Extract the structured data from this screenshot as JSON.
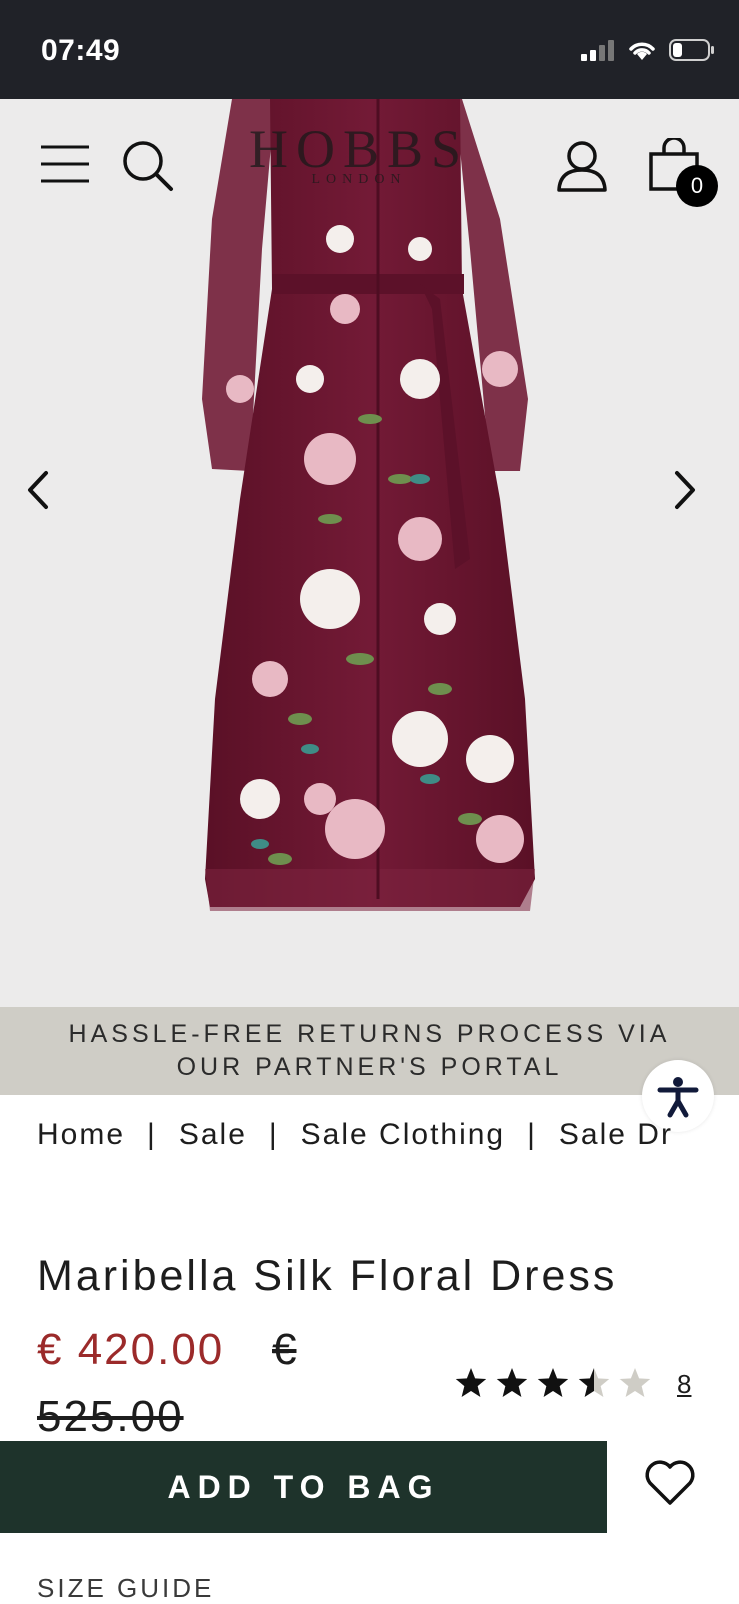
{
  "status_bar": {
    "time": "07:49"
  },
  "header": {
    "logo_main": "HOBBS",
    "logo_sub": "LONDON",
    "cart_count": "0"
  },
  "gallery": {
    "slide_count": 6,
    "active_index": 1
  },
  "banner": {
    "line1": "HASSLE-FREE RETURNS PROCESS VIA",
    "line2": "OUR PARTNER'S PORTAL"
  },
  "breadcrumb": [
    "Home",
    "Sale",
    "Sale Clothing",
    "Sale Dr"
  ],
  "product": {
    "title": "Maribella Silk Floral Dress",
    "price": "€ 420.00",
    "old_price_part1": "€",
    "old_price_part2": "525.00",
    "rating_value": 3.5,
    "rating_max": 5,
    "review_count": "8"
  },
  "actions": {
    "add_to_bag": "ADD TO BAG",
    "size_guide": "SIZE GUIDE"
  },
  "colors": {
    "status_bar": "#202228",
    "add_to_bag_bg": "#1e332b",
    "sale_price": "#9b2a2a",
    "banner_bg": "#cfcdc6",
    "dress": "#6b1530"
  }
}
